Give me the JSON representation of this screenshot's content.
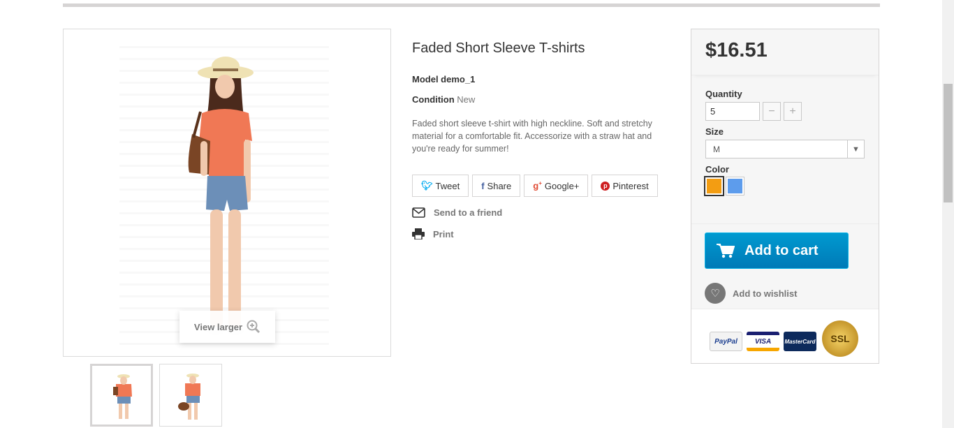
{
  "product": {
    "title": "Faded Short Sleeve T-shirts",
    "model_label": "Model demo_1",
    "condition_label": "Condition",
    "condition_value": "New",
    "description": "Faded short sleeve t-shirt with high neckline. Soft and stretchy material for a comfortable fit. Accessorize with a straw hat and you're ready for summer!"
  },
  "image": {
    "view_larger": "View larger"
  },
  "social": {
    "tweet": "Tweet",
    "share": "Share",
    "googleplus": "Google+",
    "pinterest": "Pinterest"
  },
  "links": {
    "send_friend": "Send to a friend",
    "print": "Print"
  },
  "buybox": {
    "price": "$16.51",
    "quantity_label": "Quantity",
    "quantity_value": "5",
    "minus": "−",
    "plus": "+",
    "size_label": "Size",
    "size_value": "M",
    "color_label": "Color",
    "colors": [
      "#f39d12",
      "#5d9cec"
    ],
    "add_to_cart": "Add to cart",
    "add_to_wishlist": "Add to wishlist",
    "payments": [
      "PayPal",
      "VISA",
      "MasterCard",
      "SSL"
    ]
  },
  "colors": {
    "cart_button": "#0089c9",
    "accent_gray": "#777777"
  }
}
